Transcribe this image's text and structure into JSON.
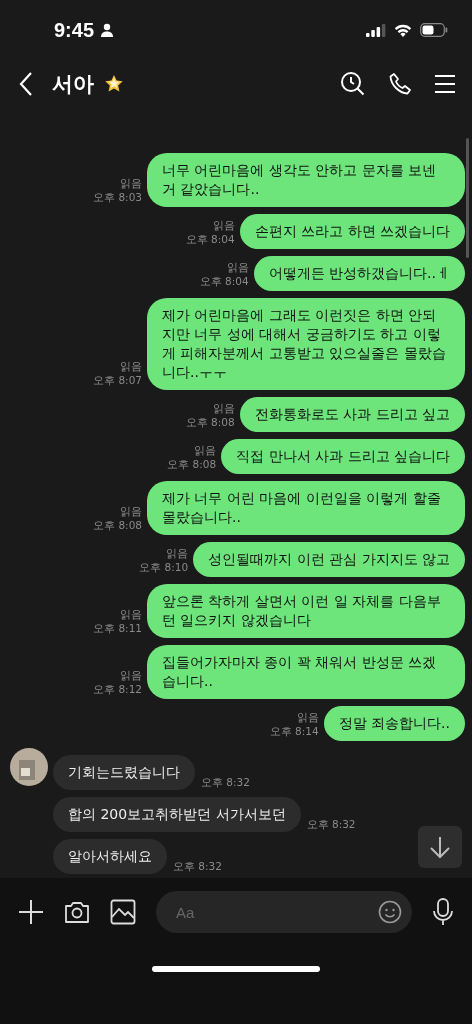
{
  "status_bar": {
    "time": "9:45"
  },
  "header": {
    "title": "서아"
  },
  "messages": [
    {
      "kind": "sent",
      "text": "너무 어린마음에 생각도 안하고 문자를 보넨거 같았습니다..",
      "read": "읽음",
      "time": "오후 8:03"
    },
    {
      "kind": "sent",
      "text": "손편지 쓰라고 하면 쓰겠습니다",
      "read": "읽음",
      "time": "오후 8:04"
    },
    {
      "kind": "sent",
      "text": "어떻게든 반성하갰습니다..ㅔ",
      "read": "읽음",
      "time": "오후 8:04"
    },
    {
      "kind": "sent",
      "text": "제가 어린마음에 그래도 이런짓은 하면 안되지만 너무 성에 대해서 궁금하기도 하고 이렇게 피해자분께서 고통받고 있으실줄은 몰랐습니다..ㅜㅜ",
      "read": "읽음",
      "time": "오후 8:07"
    },
    {
      "kind": "sent",
      "text": "전화통화로도 사과 드리고 싶고",
      "read": "읽음",
      "time": "오후 8:08"
    },
    {
      "kind": "sent",
      "text": "직접 만나서 사과 드리고 싶습니다",
      "read": "읽음",
      "time": "오후 8:08"
    },
    {
      "kind": "sent",
      "text": "제가 너무 어린 마음에 이런일을 이렇게 할줄 몰랐습니다..",
      "read": "읽음",
      "time": "오후 8:08"
    },
    {
      "kind": "sent",
      "text": "성인될때까지 이런 관심 가지지도 않고",
      "read": "읽음",
      "time": "오후 8:10"
    },
    {
      "kind": "sent",
      "text": "앞으론 착하게 살면서 이런 일 자체를 다음부턴 일으키지 않겠습니다",
      "read": "읽음",
      "time": "오후 8:11"
    },
    {
      "kind": "sent",
      "text": "집들어가자마자 종이 꽉 채워서 반성문 쓰겠습니다..",
      "read": "읽음",
      "time": "오후 8:12"
    },
    {
      "kind": "sent",
      "text": "정말 죄송합니다..",
      "read": "읽음",
      "time": "오후 8:14"
    },
    {
      "kind": "received",
      "avatar": true,
      "text": "기회는드렸습니다",
      "time": "오후 8:32"
    },
    {
      "kind": "received",
      "avatar": false,
      "text": "합의 200보고취하받던 서가서보던",
      "time": "오후 8:32"
    },
    {
      "kind": "received",
      "avatar": false,
      "text": "알아서하세요",
      "time": "오후 8:32"
    }
  ],
  "composer": {
    "placeholder": "Aa"
  }
}
